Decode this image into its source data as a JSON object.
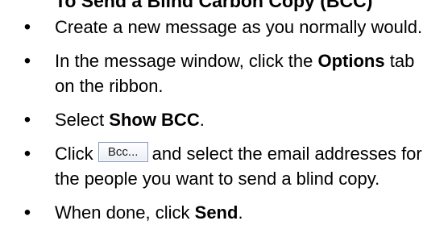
{
  "heading": {
    "text": "To Send a Blind Carbon Copy (BCC)"
  },
  "steps": [
    {
      "text": "Create a new message as you normally would."
    },
    {
      "before": "In the message window, click the ",
      "bold": "Options",
      "after": " tab on the ribbon."
    },
    {
      "before": "Select ",
      "bold": "Show BCC",
      "after": "."
    },
    {
      "before": "Click",
      "button_label": "Bcc...",
      "after": "and select the email addresses for the people you want to send a blind copy."
    },
    {
      "before": "When done, click ",
      "bold": "Send",
      "after": "."
    }
  ]
}
